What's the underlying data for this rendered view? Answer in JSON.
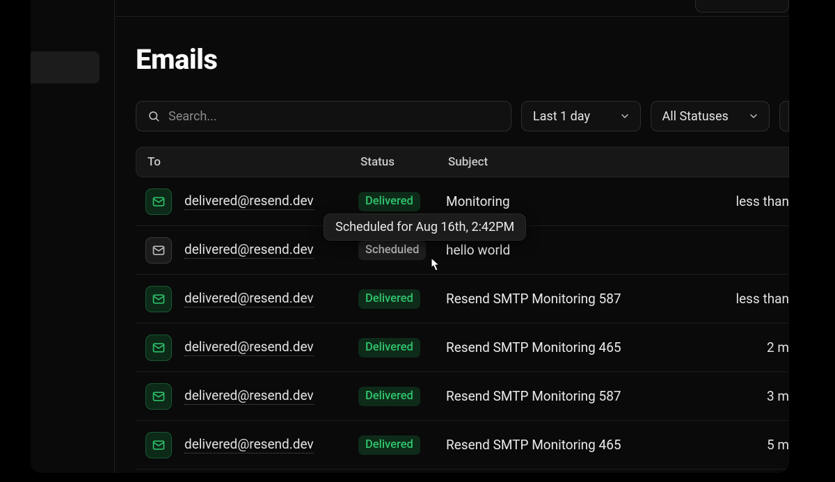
{
  "page": {
    "title": "Emails"
  },
  "search": {
    "placeholder": "Search..."
  },
  "filters": {
    "date": "Last 1 day",
    "status": "All Statuses"
  },
  "columns": {
    "to": "To",
    "status": "Status",
    "subject": "Subject"
  },
  "tooltip": "Scheduled for Aug 16th, 2:42PM",
  "rows": [
    {
      "to": "delivered@resend.dev",
      "status": "Delivered",
      "statusKey": "delivered",
      "subject": "Monitoring",
      "time": "less than"
    },
    {
      "to": "delivered@resend.dev",
      "status": "Scheduled",
      "statusKey": "scheduled",
      "subject": "hello world",
      "time": ""
    },
    {
      "to": "delivered@resend.dev",
      "status": "Delivered",
      "statusKey": "delivered",
      "subject": "Resend SMTP Monitoring 587",
      "time": "less than"
    },
    {
      "to": "delivered@resend.dev",
      "status": "Delivered",
      "statusKey": "delivered",
      "subject": "Resend SMTP Monitoring 465",
      "time": "2 m"
    },
    {
      "to": "delivered@resend.dev",
      "status": "Delivered",
      "statusKey": "delivered",
      "subject": "Resend SMTP Monitoring 587",
      "time": "3 m"
    },
    {
      "to": "delivered@resend.dev",
      "status": "Delivered",
      "statusKey": "delivered",
      "subject": "Resend SMTP Monitoring 465",
      "time": "5 m"
    }
  ]
}
